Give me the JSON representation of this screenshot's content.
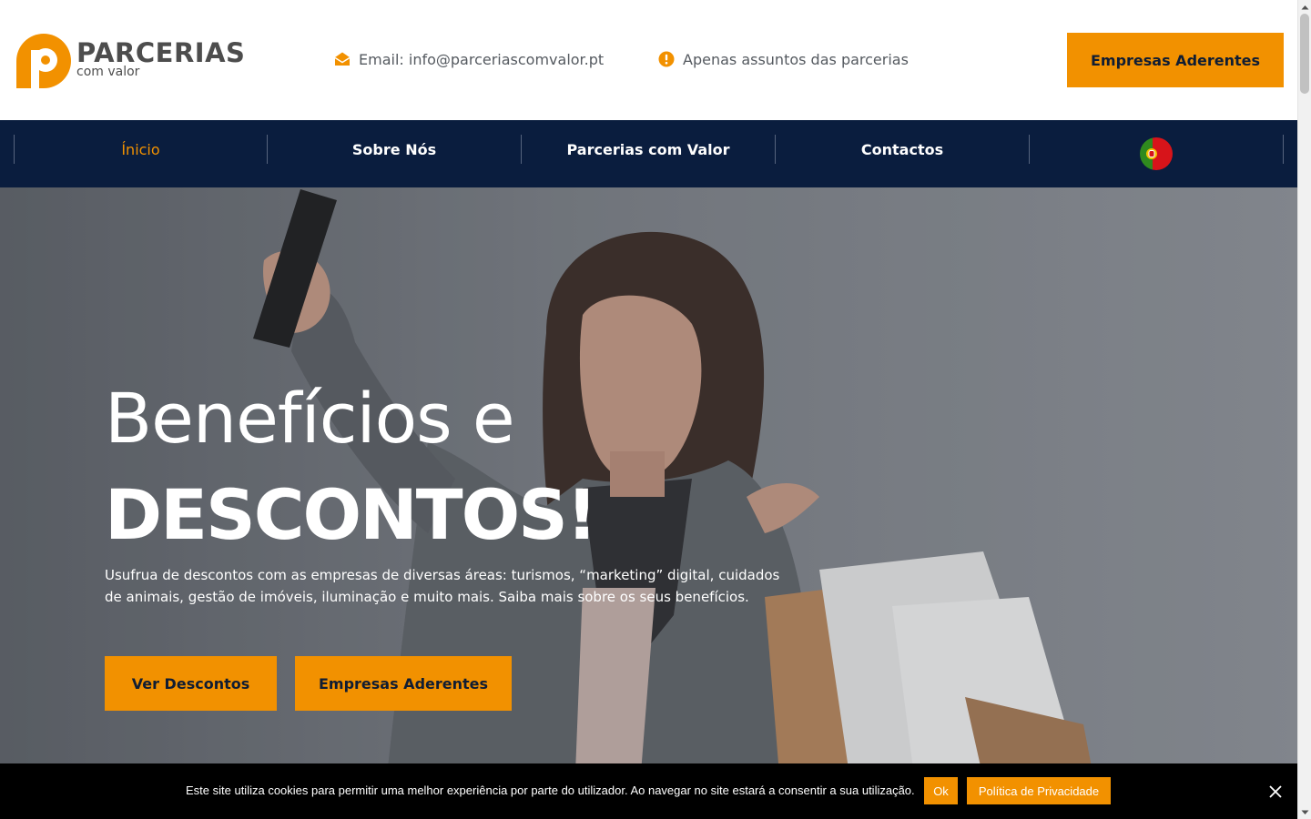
{
  "header": {
    "logo_title": "PARCERIAS",
    "logo_subtitle": "com valor",
    "email_text": "Email: info@parceriascomvalor.pt",
    "notice_text": "Apenas assuntos das parcerias",
    "cta_label": "Empresas Aderentes"
  },
  "nav": {
    "items": [
      {
        "label": "Ínicio",
        "active": true
      },
      {
        "label": "Sobre Nós",
        "active": false
      },
      {
        "label": "Parcerias com Valor",
        "active": false
      },
      {
        "label": "Contactos",
        "active": false
      }
    ],
    "language_icon": "portugal-flag-icon"
  },
  "hero": {
    "title_line1": "Benefícios e",
    "title_line2": "DESCONTOS!",
    "description": "Usufrua de descontos com as empresas de diversas áreas: turismos, “marketing” digital, cuidados de animais, gestão de imóveis, iluminação e muito mais. Saiba mais sobre os seus benefícios.",
    "buttons": {
      "primary": "Ver Descontos",
      "secondary": "Empresas Aderentes"
    }
  },
  "cookie_bar": {
    "text": "Este site utiliza cookies para permitir uma melhor experiência por parte do utilizador. Ao navegar no site estará a consentir a sua utilização.",
    "ok_label": "Ok",
    "policy_label": "Política de Privacidade"
  },
  "icons": {
    "email": "envelope-open-icon",
    "notice": "exclamation-circle-icon",
    "close": "close-icon"
  },
  "colors": {
    "accent": "#f29100",
    "nav_background": "#0a1d3e",
    "text_dark": "#101d33",
    "text_muted": "#555a60",
    "cookie_background": "#000000"
  }
}
